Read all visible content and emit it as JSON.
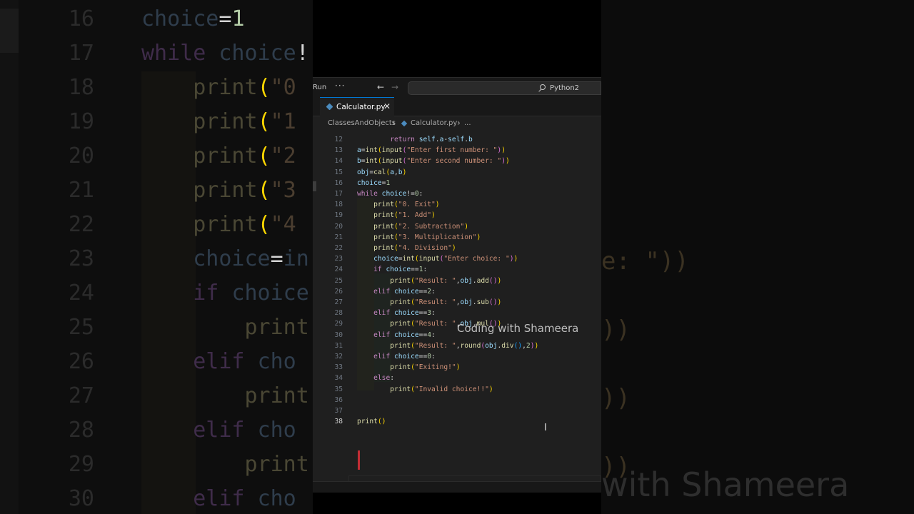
{
  "titlebar": {
    "run": "Run",
    "more": "···",
    "search_label": "Python2"
  },
  "tab": {
    "label": "Calculator.py",
    "close": "✕"
  },
  "breadcrumb": {
    "folder": "ClassesAndObjects",
    "file": "Calculator.py",
    "ellipsis": "..."
  },
  "code_lines": [
    {
      "n": "12",
      "t": "        return self.a-self.b"
    },
    {
      "n": "13",
      "t": "a=int(input(\"Enter first number: \"))"
    },
    {
      "n": "14",
      "t": "b=int(input(\"Enter second number: \"))"
    },
    {
      "n": "15",
      "t": "obj=cal(a,b)"
    },
    {
      "n": "16",
      "t": "choice=1"
    },
    {
      "n": "17",
      "t": "while choice!=0:"
    },
    {
      "n": "18",
      "t": "    print(\"0. Exit\")"
    },
    {
      "n": "19",
      "t": "    print(\"1. Add\")"
    },
    {
      "n": "20",
      "t": "    print(\"2. Subtraction\")"
    },
    {
      "n": "21",
      "t": "    print(\"3. Multiplication\")"
    },
    {
      "n": "22",
      "t": "    print(\"4. Division\")"
    },
    {
      "n": "23",
      "t": "    choice=int(input(\"Enter choice: \"))"
    },
    {
      "n": "24",
      "t": "    if choice==1:"
    },
    {
      "n": "25",
      "t": "        print(\"Result: \",obj.add())"
    },
    {
      "n": "26",
      "t": "    elif choice==2:"
    },
    {
      "n": "27",
      "t": "        print(\"Result: \",obj.sub())"
    },
    {
      "n": "28",
      "t": "    elif choice==3:"
    },
    {
      "n": "29",
      "t": "        print(\"Result: \",obj.mul())"
    },
    {
      "n": "30",
      "t": "    elif choice==4:"
    },
    {
      "n": "31",
      "t": "        print(\"Result: \",round(obj.div(),2))"
    },
    {
      "n": "32",
      "t": "    elif choice==0:"
    },
    {
      "n": "33",
      "t": "        print(\"Exiting!\")"
    },
    {
      "n": "34",
      "t": "    else:"
    },
    {
      "n": "35",
      "t": "        print(\"Invalid choice!!\")"
    },
    {
      "n": "36",
      "t": ""
    },
    {
      "n": "37",
      "t": ""
    },
    {
      "n": "38",
      "t": "print()"
    }
  ],
  "watermark": "Coding with Shameera",
  "bg_watermark": "with Shameera",
  "bg_left_lines": [
    {
      "n": "16",
      "t": "choice=1"
    },
    {
      "n": "17",
      "t": "while choice!"
    },
    {
      "n": "18",
      "t": "    print(\"0"
    },
    {
      "n": "19",
      "t": "    print(\"1"
    },
    {
      "n": "20",
      "t": "    print(\"2"
    },
    {
      "n": "21",
      "t": "    print(\"3"
    },
    {
      "n": "22",
      "t": "    print(\"4"
    },
    {
      "n": "23",
      "t": "    choice=in"
    },
    {
      "n": "24",
      "t": "    if choice"
    },
    {
      "n": "25",
      "t": "        print"
    },
    {
      "n": "26",
      "t": "    elif cho"
    },
    {
      "n": "27",
      "t": "        print"
    },
    {
      "n": "28",
      "t": "    elif cho"
    },
    {
      "n": "29",
      "t": "        print"
    },
    {
      "n": "30",
      "t": "    elif cho"
    }
  ],
  "bg_right_text": "e: \"))",
  "bg_right_parens": [
    "))",
    "))",
    "))",
    "))"
  ],
  "colors": {
    "keyword": "#c586c0",
    "function": "#dcdcaa",
    "variable": "#9cdcfe",
    "string": "#ce9178",
    "accent": "#0078d4",
    "error": "#e0303a"
  }
}
